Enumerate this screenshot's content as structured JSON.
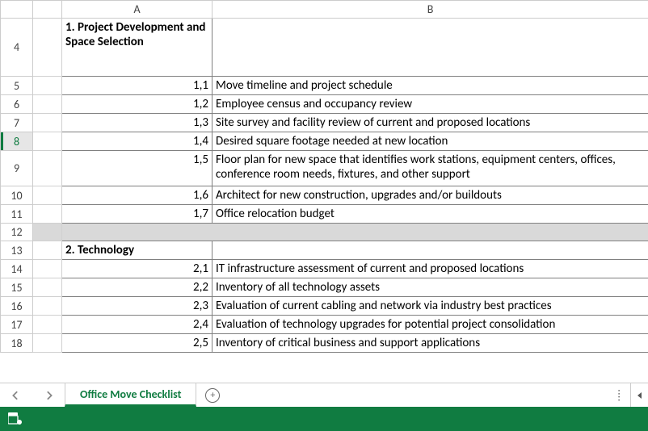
{
  "columns": {
    "A": "A",
    "B": "B"
  },
  "rows": [
    {
      "num": "",
      "a_bold": true,
      "a": "1. Project Development and Space Selection",
      "b": "",
      "cls": "head"
    },
    {
      "num": "4",
      "continuation": true
    },
    {
      "num": "5",
      "a": "1,1",
      "b": "Move timeline and project schedule"
    },
    {
      "num": "6",
      "a": "1,2",
      "b": "Employee census and occupancy review"
    },
    {
      "num": "7",
      "a": "1,3",
      "b": "Site survey and facility review of current and proposed locations"
    },
    {
      "num": "8",
      "a": "1,4",
      "b": "Desired square footage needed at new location",
      "sel": true
    },
    {
      "num": "9",
      "a": "1,5",
      "b": "Floor plan for  new space that identifies work stations, equipment centers, offices, conference room needs, fixtures, and other support",
      "cls": "tall"
    },
    {
      "num": "10",
      "a": "1,6",
      "b": "Architect for new construction, upgrades and/or buildouts"
    },
    {
      "num": "11",
      "a": "1,7",
      "b": "Office relocation budget"
    },
    {
      "num": "12",
      "sep": true
    },
    {
      "num": "13",
      "a_bold": true,
      "a": "2. Technology",
      "b": ""
    },
    {
      "num": "14",
      "a": "2,1",
      "b": "IT infrastructure assessment of current and proposed locations"
    },
    {
      "num": "15",
      "a": "2,2",
      "b": "Inventory of all technology assets"
    },
    {
      "num": "16",
      "a": "2,3",
      "b": "Evaluation of current cabling and network via industry best practices"
    },
    {
      "num": "17",
      "a": "2,4",
      "b": "Evaluation of technology upgrades for potential project consolidation"
    },
    {
      "num": "18",
      "a": "2,5",
      "b": "Inventory of critical business and support applications"
    }
  ],
  "sheet_tab": "Office Move Checklist"
}
